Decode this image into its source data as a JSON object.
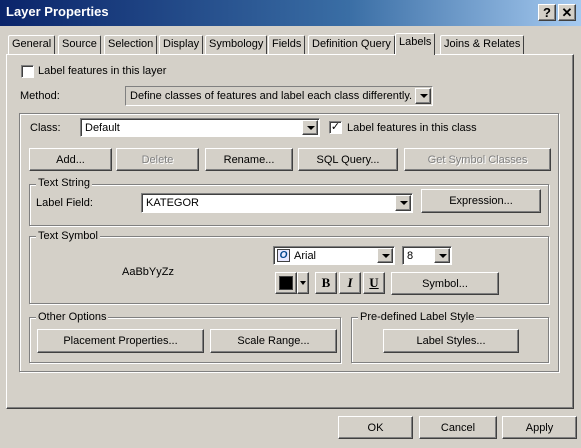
{
  "window": {
    "title": "Layer Properties",
    "help_glyph": "?",
    "close_glyph": "✕"
  },
  "tabs": [
    {
      "label": "General"
    },
    {
      "label": "Source"
    },
    {
      "label": "Selection"
    },
    {
      "label": "Display"
    },
    {
      "label": "Symbology"
    },
    {
      "label": "Fields"
    },
    {
      "label": "Definition Query"
    },
    {
      "label": "Labels",
      "active": true
    },
    {
      "label": "Joins & Relates"
    }
  ],
  "labels_tab": {
    "label_features_in_layer": {
      "label": "Label features in this layer",
      "checked": false
    },
    "method": {
      "label": "Method:",
      "value": "Define classes of features and label each class differently."
    },
    "class": {
      "label": "Class:",
      "value": "Default",
      "label_features_in_class": {
        "label": "Label features in this class",
        "checked": true,
        "mark": "✓"
      }
    },
    "buttons": {
      "add": "Add...",
      "delete": "Delete",
      "rename": "Rename...",
      "sql_query": "SQL Query...",
      "get_symbol_classes": "Get Symbol Classes"
    },
    "text_string": {
      "group_title": "Text String",
      "label_field_label": "Label Field:",
      "label_field_value": "KATEGOR",
      "expression_button": "Expression..."
    },
    "text_symbol": {
      "group_title": "Text Symbol",
      "preview_text": "AaBbYyZz",
      "font_icon_glyph": "O",
      "font_value": "Arial",
      "size_value": "8",
      "color": "#000000",
      "bold": "B",
      "italic": "I",
      "underline": "U",
      "symbol_button": "Symbol..."
    },
    "other_options": {
      "group_title": "Other Options",
      "placement_button": "Placement Properties...",
      "scale_button": "Scale Range..."
    },
    "predefined": {
      "group_title": "Pre-defined Label Style",
      "label_styles_button": "Label Styles..."
    }
  },
  "footer": {
    "ok": "OK",
    "cancel": "Cancel",
    "apply": "Apply"
  }
}
